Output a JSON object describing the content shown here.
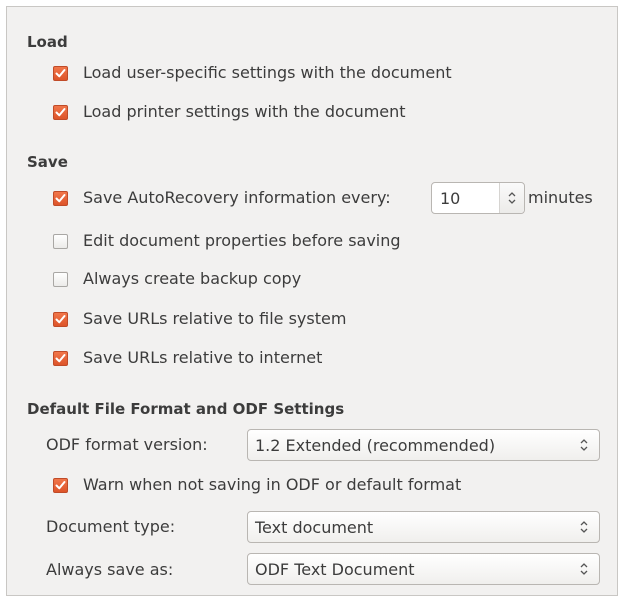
{
  "load": {
    "heading": "Load",
    "user_settings": {
      "label": "Load user-specific settings with the document",
      "checked": true
    },
    "printer_settings": {
      "label": "Load printer settings with the document",
      "checked": true
    }
  },
  "save": {
    "heading": "Save",
    "autorecovery": {
      "label": "Save AutoRecovery information every:",
      "checked": true,
      "value": "10",
      "unit": "minutes"
    },
    "edit_properties": {
      "label": "Edit document properties before saving",
      "checked": false
    },
    "backup_copy": {
      "label": "Always create backup copy",
      "checked": false
    },
    "urls_filesystem": {
      "label": "Save URLs relative to file system",
      "checked": true
    },
    "urls_internet": {
      "label": "Save URLs relative to internet",
      "checked": true
    }
  },
  "format": {
    "heading": "Default File Format and ODF Settings",
    "odf_version": {
      "label": "ODF format version:",
      "selected": "1.2 Extended (recommended)"
    },
    "warn": {
      "label": "Warn when not saving in ODF or default format",
      "checked": true
    },
    "document_type": {
      "label": "Document type:",
      "selected": "Text document"
    },
    "save_as": {
      "label": "Always save as:",
      "selected": "ODF Text Document"
    }
  },
  "colors": {
    "accent": "#e8603a",
    "panel_bg": "#f2f1f0",
    "text": "#3c3c3c"
  }
}
